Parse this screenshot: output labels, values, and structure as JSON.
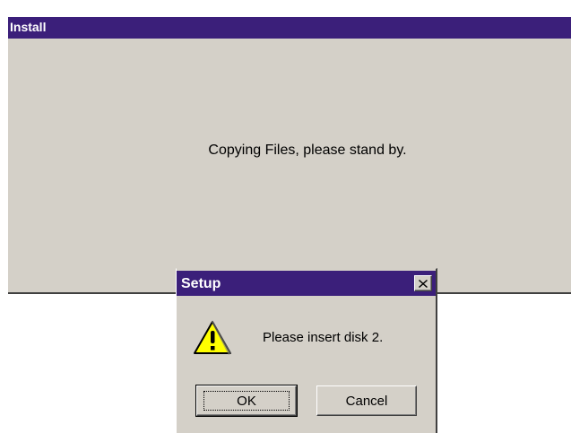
{
  "install_window": {
    "title": "Install",
    "message": "Copying Files, please stand by."
  },
  "setup_dialog": {
    "title": "Setup",
    "message": "Please insert disk 2.",
    "icon": "warning-icon",
    "close_label": "close-icon",
    "ok_label": "OK",
    "cancel_label": "Cancel"
  },
  "colors": {
    "titlebar": "#3b1f7a",
    "face": "#d4d0c8",
    "warning_yellow": "#ffff00"
  }
}
